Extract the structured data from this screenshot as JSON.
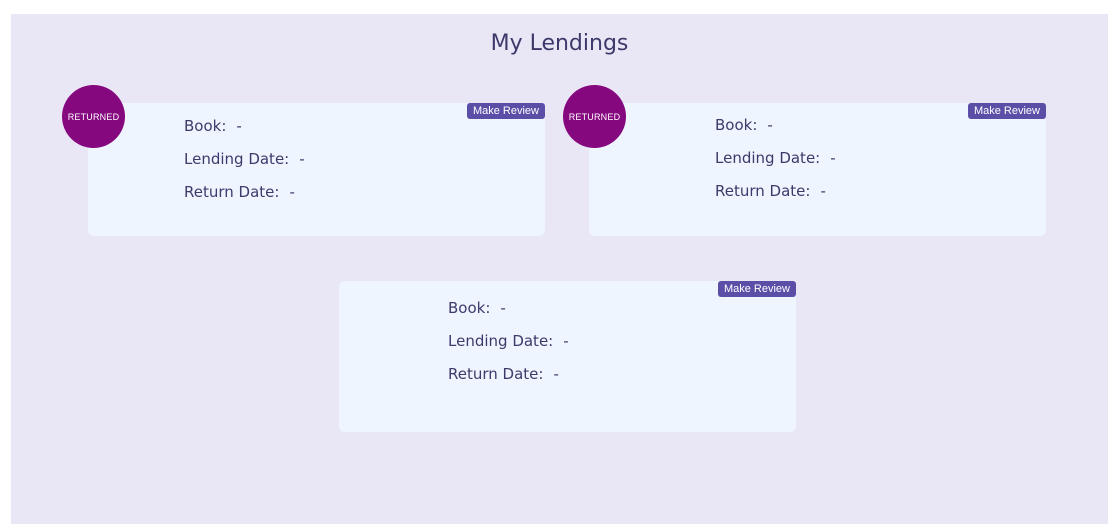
{
  "page": {
    "title": "My Lendings"
  },
  "lendings": [
    {
      "status": "RETURNED",
      "review_label": "Make Review",
      "book_label": "Book:",
      "book_value": "-",
      "lending_label": "Lending Date:",
      "lending_value": "-",
      "return_label": "Return Date:",
      "return_value": "-"
    },
    {
      "status": "RETURNED",
      "review_label": "Make Review",
      "book_label": "Book:",
      "book_value": "-",
      "lending_label": "Lending Date:",
      "lending_value": "-",
      "return_label": "Return Date:",
      "return_value": "-"
    },
    {
      "review_label": "Make Review",
      "book_label": "Book:",
      "book_value": "-",
      "lending_label": "Lending Date:",
      "lending_value": "-",
      "return_label": "Return Date:",
      "return_value": "-"
    }
  ],
  "colors": {
    "panel_bg": "#e9e7f6",
    "card_bg": "#eef5fe",
    "text": "#3d3a6b",
    "accent": "#5a4ea7",
    "returned_badge": "#85087f"
  }
}
